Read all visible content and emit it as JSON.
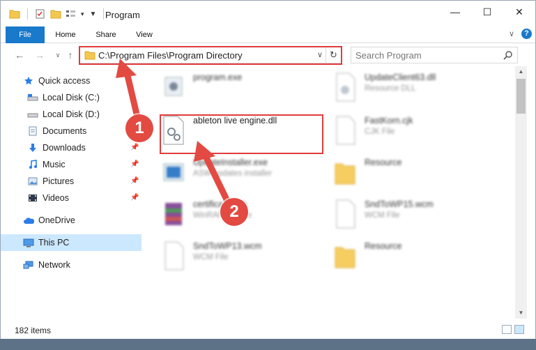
{
  "window": {
    "title": "Program",
    "minimize": "—",
    "maximize": "☐",
    "close": "✕"
  },
  "ribbon": {
    "tabs": [
      "File",
      "Home",
      "Share",
      "View"
    ],
    "expand": "∨",
    "help": "?"
  },
  "nav": {
    "back": "←",
    "forward": "→",
    "recent": "∨",
    "up": "↑",
    "address": "C:\\Program Files\\Program Directory",
    "refresh": "↻",
    "search_placeholder": "Search Program"
  },
  "sidebar": {
    "items": [
      {
        "label": "Quick access",
        "icon": "star-icon"
      },
      {
        "label": "Local Disk (C:)",
        "icon": "drive-icon"
      },
      {
        "label": "Local Disk (D:)",
        "icon": "drive-icon"
      },
      {
        "label": "Documents",
        "icon": "documents-icon"
      },
      {
        "label": "Downloads",
        "icon": "downloads-icon"
      },
      {
        "label": "Music",
        "icon": "music-icon"
      },
      {
        "label": "Pictures",
        "icon": "pictures-icon"
      },
      {
        "label": "Videos",
        "icon": "videos-icon"
      },
      {
        "label": "OneDrive",
        "icon": "cloud-icon"
      },
      {
        "label": "This PC",
        "icon": "computer-icon"
      },
      {
        "label": "Network",
        "icon": "network-icon"
      }
    ]
  },
  "files": [
    {
      "name": "program.exe",
      "type": ""
    },
    {
      "name": "UpdateClient63.dll",
      "type": "Resource DLL"
    },
    {
      "name": "ableton live engine.dll",
      "type": ""
    },
    {
      "name": "FastKorn.cjk",
      "type": "CJK File"
    },
    {
      "name": "UpdateInstaller.exe",
      "type": "ASW updates installer"
    },
    {
      "name": "Resource",
      "type": ""
    },
    {
      "name": "certificate.cab",
      "type": "WinRAR archive"
    },
    {
      "name": "SndToWP15.wcm",
      "type": "WCM File"
    },
    {
      "name": "SndToWP13.wcm",
      "type": "WCM File"
    },
    {
      "name": "Resource",
      "type": ""
    }
  ],
  "status": {
    "item_count": "182 items"
  },
  "annotations": {
    "step1": "1",
    "step2": "2",
    "color": "#e24a42"
  },
  "colors": {
    "accent": "#1979ca",
    "highlight": "#e03b3b",
    "selected": "#cce8ff"
  }
}
